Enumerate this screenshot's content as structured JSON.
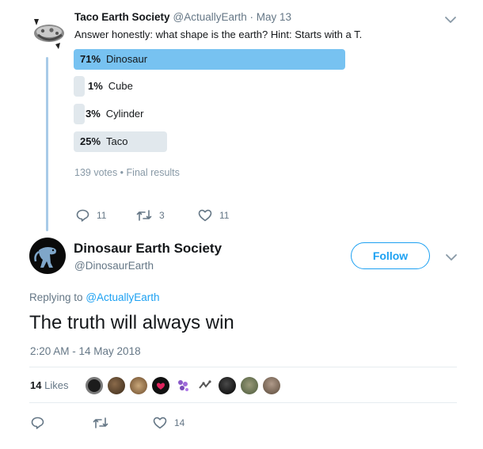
{
  "tweet1": {
    "name": "Taco Earth Society",
    "meta": "@ActuallyEarth · May 13",
    "text": "Answer honestly: what shape is the earth? Hint: Starts with a T.",
    "poll": [
      {
        "pct": "71%",
        "label": "Dinosaur",
        "value": 71,
        "color": "#77c2f1"
      },
      {
        "pct": "1%",
        "label": "Cube",
        "value": 1,
        "color": "#e1e8ed"
      },
      {
        "pct": "3%",
        "label": "Cylinder",
        "value": 3,
        "color": "#e1e8ed"
      },
      {
        "pct": "25%",
        "label": "Taco",
        "value": 25,
        "color": "#e1e8ed"
      }
    ],
    "poll_summary": "139 votes • Final results",
    "actions": {
      "reply": "11",
      "retweet": "3",
      "like": "11"
    }
  },
  "tweet2": {
    "name": "Dinosaur Earth Society",
    "handle": "@DinosaurEarth",
    "follow_label": "Follow",
    "replying_prefix": "Replying to",
    "replying_handle": "@ActuallyEarth",
    "text": "The truth will always win",
    "timestamp": "2:20 AM - 14 May 2018",
    "likes_count": "14",
    "likes_label": "Likes",
    "actions": {
      "like": "14"
    }
  },
  "colors": {
    "accent": "#1da1f2",
    "thread_line": "#a8cbe8",
    "muted": "#657786"
  }
}
